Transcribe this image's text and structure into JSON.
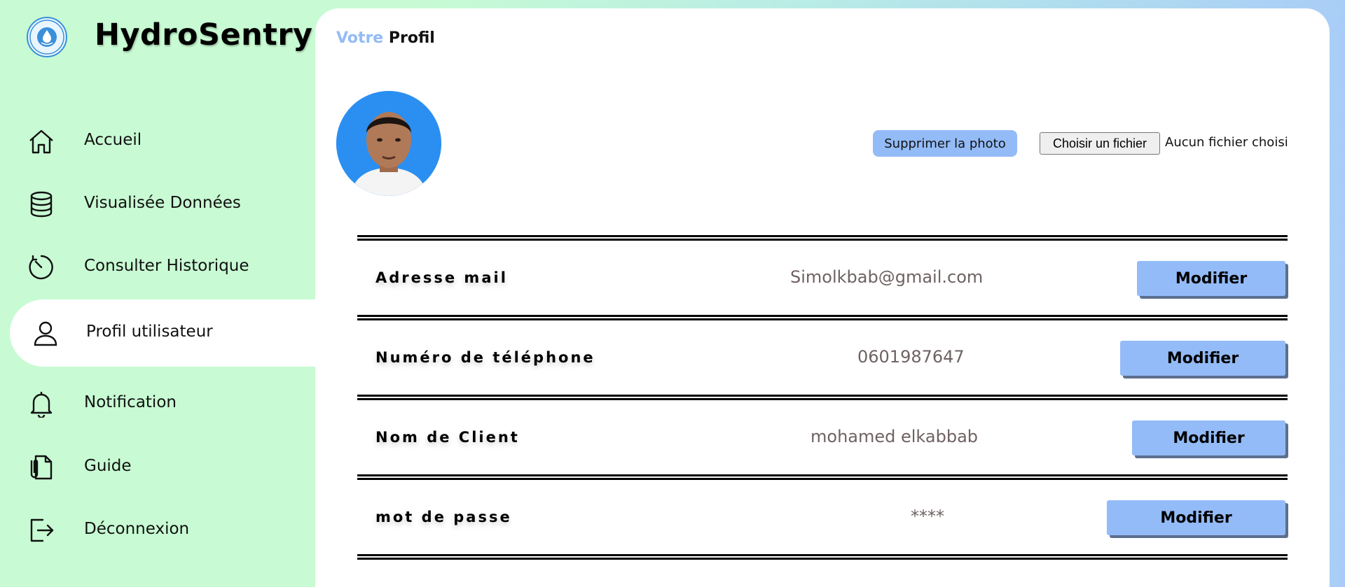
{
  "app": {
    "name": "HydroSentry",
    "logo_text_top": "HYDRO",
    "logo_text_bottom": "SENTRY"
  },
  "sidebar": {
    "items": [
      {
        "label": "Accueil",
        "icon": "home-icon"
      },
      {
        "label": "Visualisée Données",
        "icon": "database-icon"
      },
      {
        "label": "Consulter Historique",
        "icon": "timer-icon"
      },
      {
        "label": "Profil utilisateur",
        "icon": "user-icon",
        "active": true
      },
      {
        "label": "Notification",
        "icon": "bell-icon"
      },
      {
        "label": "Guide",
        "icon": "document-icon"
      },
      {
        "label": "Déconnexion",
        "icon": "logout-icon"
      }
    ]
  },
  "main": {
    "title_accent": "Votre",
    "title_rest": "Profil",
    "delete_photo_label": "Supprimer la photo",
    "file_button_label": "Choisir un fichier",
    "file_status": "Aucun fichier choisi",
    "fields": [
      {
        "label": "Adresse mail",
        "value": "Simolkbab@gmail.com",
        "button": "Modifier"
      },
      {
        "label": "Numéro de téléphone",
        "value": "0601987647",
        "button": "Modifier"
      },
      {
        "label": "Nom de Client",
        "value": "mohamed elkabbab",
        "button": "Modifier"
      },
      {
        "label": "mot de passe",
        "value": "****",
        "button": "Modifier"
      }
    ]
  },
  "colors": {
    "sidebar_bg": "#c8fbd3",
    "accent_blue": "#93bbf7",
    "avatar_bg": "#2b8ff1",
    "value_text": "#6f6262"
  }
}
